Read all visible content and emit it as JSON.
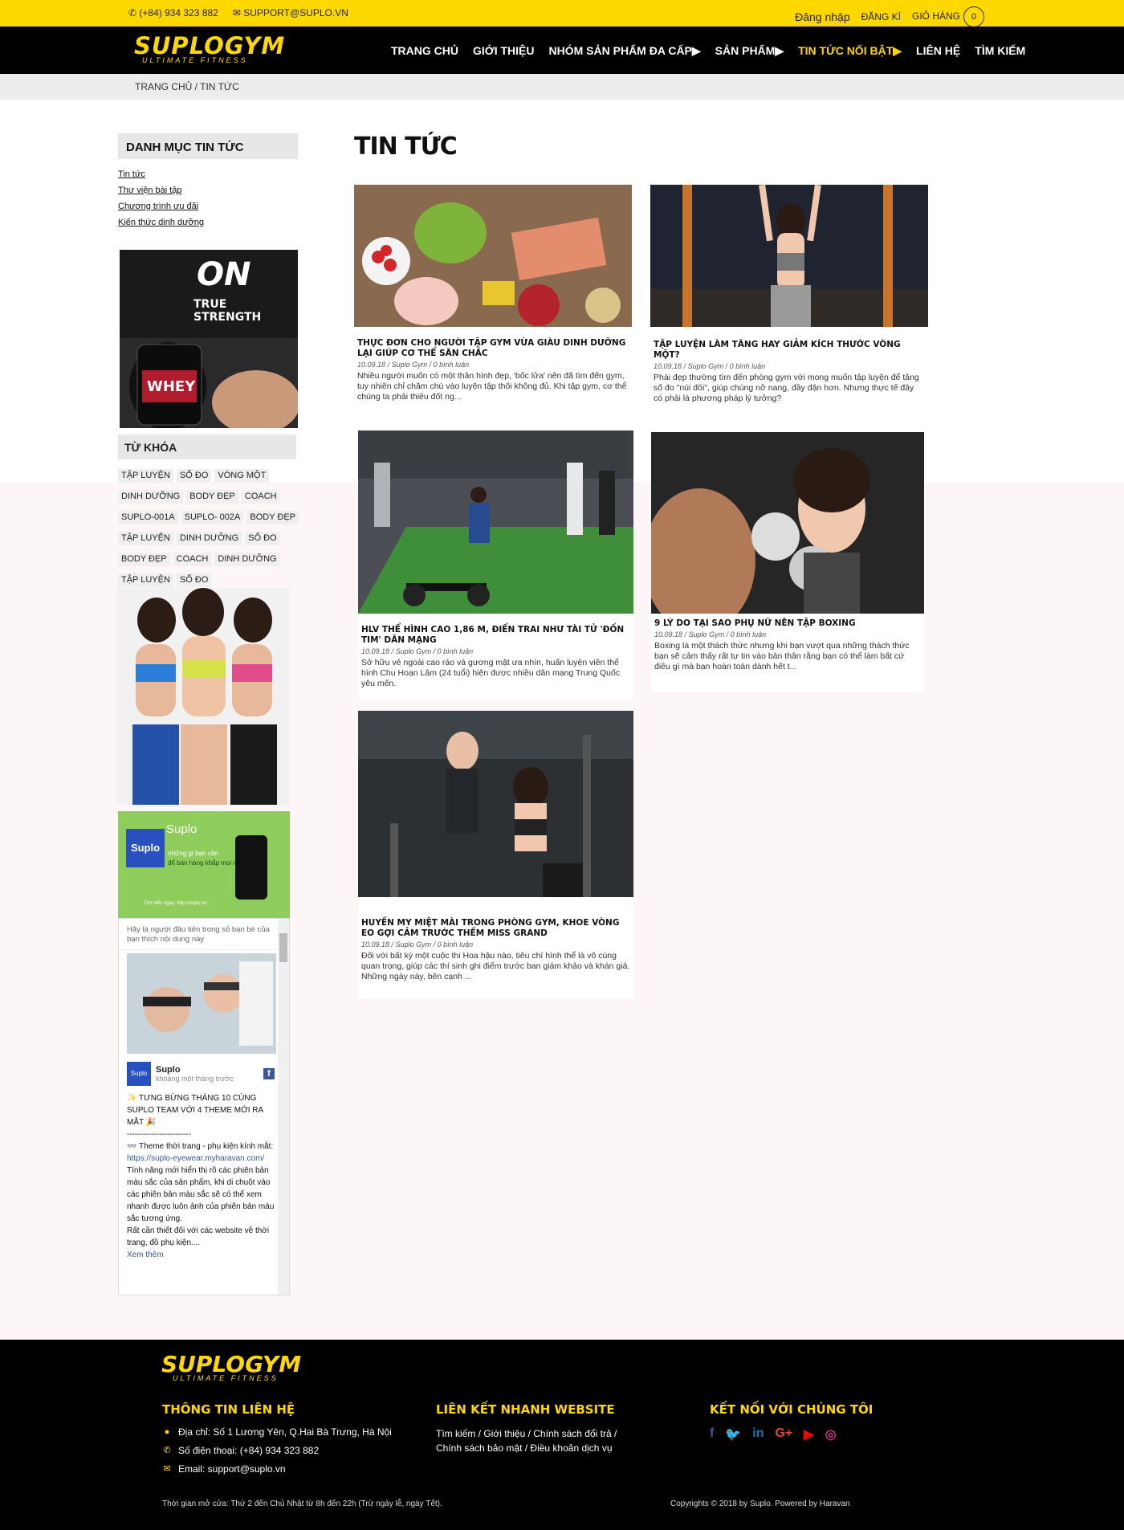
{
  "topbar": {
    "phone": "(+84) 934 323 882",
    "email": "SUPPORT@SUPLO.VN",
    "login": "Đăng nhập",
    "register": "ĐĂNG KÍ",
    "cart": "GIỎ HÀNG",
    "cart_count": "0"
  },
  "brand": {
    "name": "SUPLOGYM",
    "tagline": "ULTIMATE FITNESS"
  },
  "menu": {
    "items": [
      "TRANG CHỦ",
      "GIỚI THIỆU",
      "NHÓM SẢN PHẨM ĐA CẤP▶",
      "SẢN PHẨM▶",
      "TIN TỨC NỔI BẬT▶",
      "LIÊN HỆ",
      "TÌM KIẾM"
    ]
  },
  "breadcrumb": "TRANG CHỦ / TIN TỨC",
  "sidebar": {
    "categories_title": "DANH MỤC TIN TỨC",
    "categories": [
      "Tin tức",
      "Thư viện bài tập",
      "Chương trình ưu đãi",
      "Kiến thức dinh dưỡng"
    ],
    "promo1_text": "TRUE STRENGTH",
    "promo1_product": "WHEY",
    "promo1_logo": "ON",
    "tags_title": "TỪ KHÓA",
    "tags": [
      "TẬP LUYỆN",
      "SỐ ĐO",
      "VÒNG MỘT",
      "DINH DƯỠNG",
      "BODY ĐẸP",
      "COACH",
      "SUPLO-001A",
      "SUPLO- 002A",
      "BODY ĐẸP",
      "TẬP LUYỆN",
      "DINH DƯỠNG",
      "SỐ ĐO",
      "BODY ĐẸP",
      "COACH",
      "DINH DƯỠNG",
      "TẬP LUYỆN",
      "SỐ ĐO"
    ],
    "promo3": {
      "brand": "Suplo",
      "line1": "những gì bạn cần",
      "line2": "để bán hàng khắp mọi nơi",
      "link": "Tìm hiểu ngay: http://suplo.vn"
    },
    "facebook": {
      "invite": "Hãy là người đầu tiên trong số bạn bè của bạn thích nội dung này",
      "page_name": "Suplo",
      "time": "khoảng một tháng trước",
      "post_title": "✨ TƯNG BỪNG THÁNG 10 CÙNG SUPLO TEAM VỚI 4 THEME MỚI RA MẮT 🎉",
      "divider": "------------------------",
      "line1": "👓 Theme thời trang - phụ kiện kính mắt: ",
      "link": "https://suplo-eyewear.myharavan.com/",
      "line2": "Tính năng mới hiển thị rõ các phiên bản màu sắc của sản phẩm, khi di chuột vào các phiên bản màu sắc sẽ có thể xem nhanh được luôn ảnh của phiên bản màu sắc tương ứng.",
      "line3": "Rất cần thiết đối với các website về thời trang, đồ phụ kiện....",
      "more": "Xem thêm"
    }
  },
  "main": {
    "title": "TIN TỨC",
    "articles": [
      {
        "title": "THỰC ĐƠN CHO NGƯỜI TẬP GYM VỪA GIÀU DINH DƯỠNG LẠI GIÚP CƠ THỂ SĂN CHẮC",
        "date": "10.09.18",
        "author": "Suplo Gym",
        "comments": "0 bình luận",
        "excerpt": "Nhiều người muốn có một thân hình đẹp, 'bốc lửa' nên đã tìm đến gym, tuy nhiên chỉ chăm chú vào luyện tập thôi không đủ. Khi tập gym, cơ thể chúng ta phải thiêu đốt ng..."
      },
      {
        "title": "TẬP LUYỆN LÀM TĂNG HAY GIẢM KÍCH THƯỚC VÒNG MỘT?",
        "date": "10.09.18",
        "author": "Suplo Gym",
        "comments": "0 bình luận",
        "excerpt": "Phái đẹp thường tìm đến phòng gym với mong muốn tập luyện để tăng số đo \"núi đôi\", giúp chúng nở nang, đầy đặn hơn. Nhưng thực tế đây có phải là phương pháp lý tưởng?"
      },
      {
        "title": "HLV THỂ HÌNH CAO 1,86 M, ĐIỂN TRAI NHƯ TÀI TỬ 'ĐỐN TIM' DÂN MẠNG",
        "date": "10.09.18",
        "author": "Suplo Gym",
        "comments": "0 bình luận",
        "excerpt": "Sở hữu vẻ ngoài cao ráo và gương mặt ưa nhìn, huấn luyện viên thể hình Chu Hoạn Lâm (24 tuổi) hiện được nhiều dân mạng Trung Quốc yêu mến."
      },
      {
        "title": "9 LÝ DO TẠI SAO PHỤ NỮ NÊN TẬP BOXING",
        "date": "10.09.18",
        "author": "Suplo Gym",
        "comments": "0 bình luận",
        "excerpt": "Boxing là một thách thức nhưng khi bạn vượt qua những thách thức bạn sẽ cảm thấy rất tự tin vào bản thân rằng bạn có thể làm bất cứ điều gì mà bạn hoàn toàn dành hết t..."
      },
      {
        "title": "HUYỀN MY MIỆT MÀI TRONG PHÒNG GYM, KHOE VÒNG EO GỢI CẢM TRƯỚC THỀM MISS GRAND",
        "date": "10.09.18",
        "author": "Suplo Gym",
        "comments": "0 bình luận",
        "excerpt": "Đối với bất kỳ một cuộc thi Hoa hậu nào, tiêu chí hình thể là vô cùng quan trọng, giúp các thí sinh ghi điểm trước ban giám khảo và khán giả. Những ngày này, bên cạnh ..."
      }
    ]
  },
  "footer": {
    "contact_title": "THÔNG TIN LIÊN HỆ",
    "address": "Địa chỉ: Số 1 Lương Yên, Q.Hai Bà Trưng, Hà Nội",
    "phone": "Số điện thoại: (+84) 934 323 882",
    "email": "Email: support@suplo.vn",
    "links_title": "LIÊN KẾT NHANH WEBSITE",
    "links": [
      "Tìm kiếm",
      "Giới thiệu",
      "Chính sách đổi trả",
      "Chính sách bảo mật",
      "Điều khoản dịch vụ"
    ],
    "social_title": "KẾT NỐI VỚI CHÚNG TÔI",
    "hours": "Thời gian mở cửa: Thứ 2 đến Chủ Nhật từ 8h đến 22h (Trừ ngày lễ, ngày Tết).",
    "copyright": "Copyrights © 2018 by Suplo. Powered by Haravan"
  },
  "colors": {
    "accent": "#ffd800",
    "dark": "#000000"
  }
}
